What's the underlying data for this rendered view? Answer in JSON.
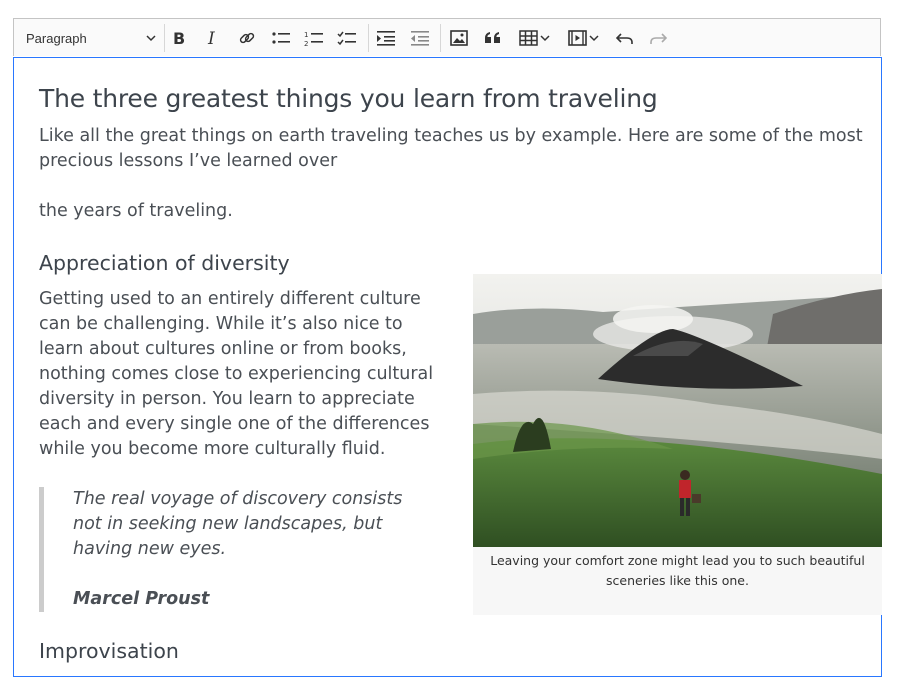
{
  "toolbar": {
    "paragraph_label": "Paragraph",
    "buttons": [
      "bold",
      "italic",
      "link",
      "bulleted-list",
      "numbered-list",
      "todo-list",
      "indent",
      "outdent",
      "insert-image",
      "block-quote",
      "insert-table",
      "insert-media",
      "undo",
      "redo"
    ]
  },
  "document": {
    "title": "The three greatest things you learn from traveling",
    "intro_line1": "Like all the great things on earth traveling teaches us by example. Here are some of the most",
    "intro_line2": "precious lessons I’ve learned over",
    "intro_line3": "the years of traveling.",
    "section1_heading": "Appreciation of diversity",
    "section1_lines": [
      "Getting used to an entirely different culture",
      "can be challenging. While it’s also nice to",
      "learn about cultures online or from books,",
      "nothing comes close to experiencing cultural",
      "diversity in person. You learn to appreciate",
      "each and every single one of the differences",
      "while you become more culturally fluid."
    ],
    "quote_lines": [
      "The real voyage of discovery consists",
      "not in seeking new landscapes, but",
      "having new eyes."
    ],
    "quote_author": "Marcel Proust",
    "section2_heading": "Improvisation",
    "figure_caption_line1": "Leaving your comfort zone might lead you to such beautiful",
    "figure_caption_line2": "sceneries like this one."
  },
  "colors": {
    "editor_border": "#2977ff",
    "toolbar_bg": "#fafafa",
    "text": "#4a4f55",
    "heading": "#3d444c"
  }
}
